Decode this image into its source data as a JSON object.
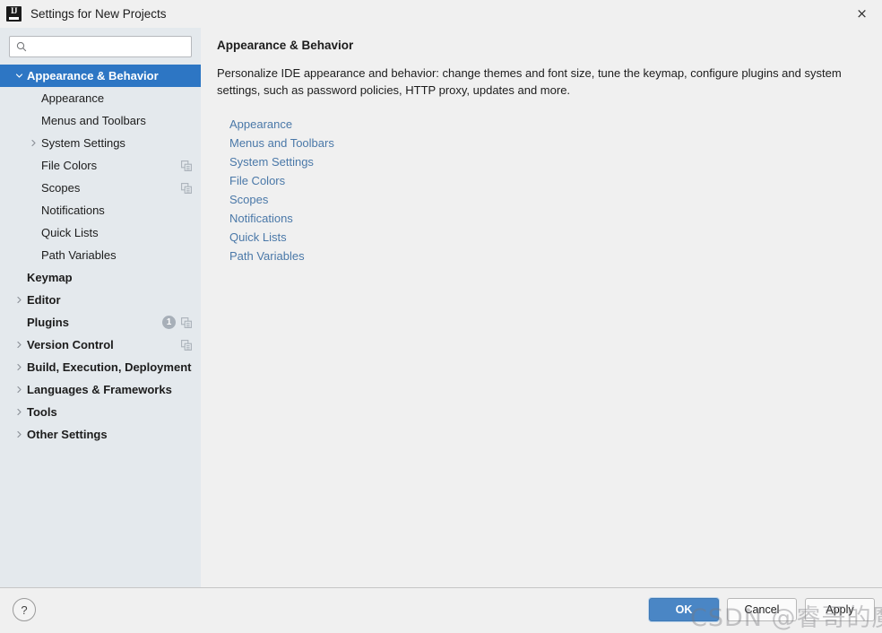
{
  "window": {
    "title": "Settings for New Projects",
    "app_icon": "intellij-idea-icon",
    "icon_letters": "IJ",
    "close_icon": "×"
  },
  "search": {
    "value": "",
    "placeholder": "",
    "icon": "search-icon"
  },
  "sidebar": {
    "background": "#e4e9ed",
    "selection_color": "#2d76c4",
    "items": [
      {
        "label": "Appearance & Behavior",
        "level": "top",
        "twisty": "down",
        "selected": true,
        "badge": null,
        "copy_icon": false
      },
      {
        "label": "Appearance",
        "level": "child",
        "twisty": "none",
        "selected": false,
        "badge": null,
        "copy_icon": false
      },
      {
        "label": "Menus and Toolbars",
        "level": "child",
        "twisty": "none",
        "selected": false,
        "badge": null,
        "copy_icon": false
      },
      {
        "label": "System Settings",
        "level": "child",
        "twisty": "right",
        "selected": false,
        "badge": null,
        "copy_icon": false
      },
      {
        "label": "File Colors",
        "level": "child",
        "twisty": "none",
        "selected": false,
        "badge": null,
        "copy_icon": true
      },
      {
        "label": "Scopes",
        "level": "child",
        "twisty": "none",
        "selected": false,
        "badge": null,
        "copy_icon": true
      },
      {
        "label": "Notifications",
        "level": "child",
        "twisty": "none",
        "selected": false,
        "badge": null,
        "copy_icon": false
      },
      {
        "label": "Quick Lists",
        "level": "child",
        "twisty": "none",
        "selected": false,
        "badge": null,
        "copy_icon": false
      },
      {
        "label": "Path Variables",
        "level": "child",
        "twisty": "none",
        "selected": false,
        "badge": null,
        "copy_icon": false
      },
      {
        "label": "Keymap",
        "level": "top",
        "twisty": "none",
        "selected": false,
        "badge": null,
        "copy_icon": false
      },
      {
        "label": "Editor",
        "level": "top",
        "twisty": "right",
        "selected": false,
        "badge": null,
        "copy_icon": false
      },
      {
        "label": "Plugins",
        "level": "top",
        "twisty": "none",
        "selected": false,
        "badge": "1",
        "copy_icon": true
      },
      {
        "label": "Version Control",
        "level": "top",
        "twisty": "right",
        "selected": false,
        "badge": null,
        "copy_icon": true
      },
      {
        "label": "Build, Execution, Deployment",
        "level": "top",
        "twisty": "right",
        "selected": false,
        "badge": null,
        "copy_icon": false
      },
      {
        "label": "Languages & Frameworks",
        "level": "top",
        "twisty": "right",
        "selected": false,
        "badge": null,
        "copy_icon": false
      },
      {
        "label": "Tools",
        "level": "top",
        "twisty": "right",
        "selected": false,
        "badge": null,
        "copy_icon": false
      },
      {
        "label": "Other Settings",
        "level": "top",
        "twisty": "right",
        "selected": false,
        "badge": null,
        "copy_icon": false
      }
    ]
  },
  "content": {
    "title": "Appearance & Behavior",
    "description": "Personalize IDE appearance and behavior: change themes and font size, tune the keymap, configure plugins and system settings, such as password policies, HTTP proxy, updates and more.",
    "link_color": "#4a78a8",
    "links": [
      {
        "label": "Appearance"
      },
      {
        "label": "Menus and Toolbars"
      },
      {
        "label": "System Settings"
      },
      {
        "label": "File Colors"
      },
      {
        "label": "Scopes"
      },
      {
        "label": "Notifications"
      },
      {
        "label": "Quick Lists"
      },
      {
        "label": "Path Variables"
      }
    ]
  },
  "bottom_bar": {
    "help_label": "?",
    "buttons": [
      {
        "label": "OK",
        "style": "primary"
      },
      {
        "label": "Cancel",
        "style": "normal"
      },
      {
        "label": "Apply",
        "style": "normal"
      }
    ]
  },
  "watermark": {
    "text": "CSDN @睿哥的魔法书"
  }
}
